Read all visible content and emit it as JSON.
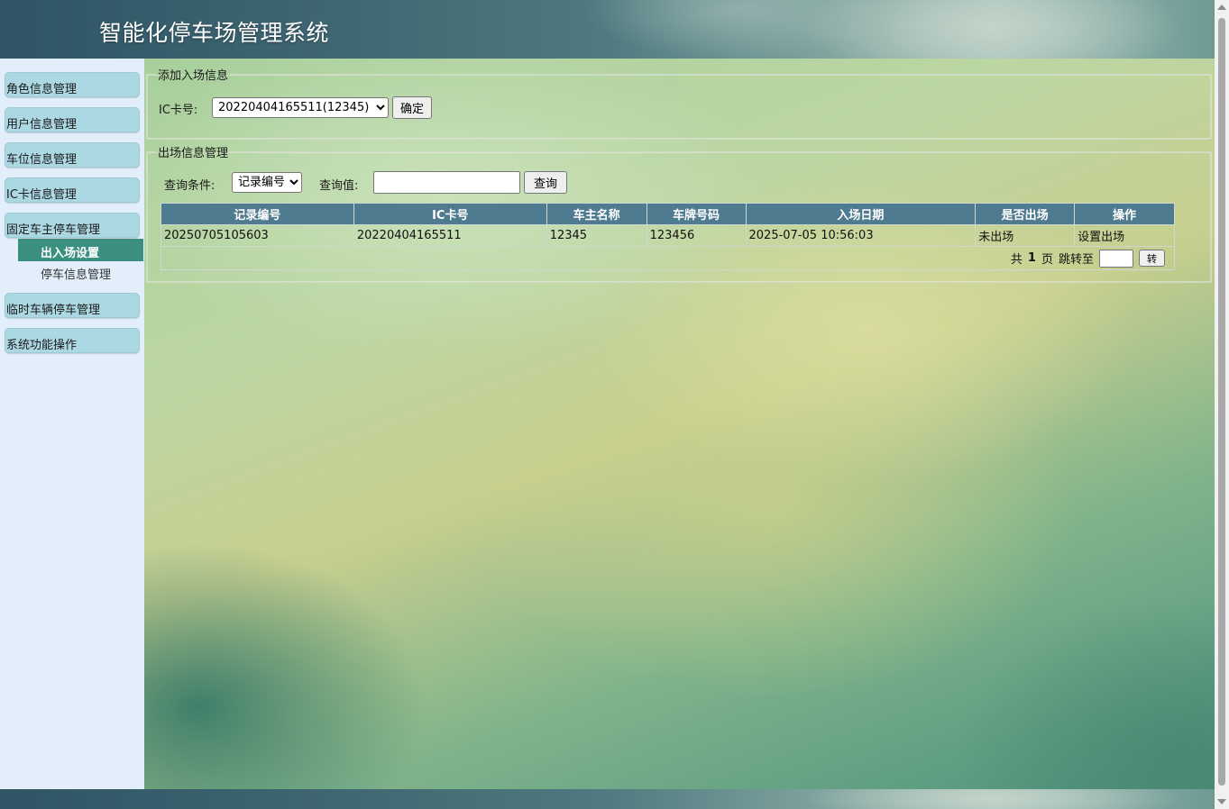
{
  "app": {
    "title": "智能化停车场管理系统"
  },
  "sidebar": {
    "items": [
      {
        "label": "角色信息管理"
      },
      {
        "label": "用户信息管理"
      },
      {
        "label": "车位信息管理"
      },
      {
        "label": "IC卡信息管理"
      },
      {
        "label": "固定车主停车管理"
      },
      {
        "label": "临时车辆停车管理"
      },
      {
        "label": "系统功能操作"
      }
    ],
    "submenu": {
      "active": "出入场设置",
      "other": "停车信息管理"
    }
  },
  "add_panel": {
    "legend": "添加入场信息",
    "ic_label": "IC卡号:",
    "ic_selected": "20220404165511(12345)",
    "confirm_label": "确定"
  },
  "exit_panel": {
    "legend": "出场信息管理",
    "query_condition_label": "查询条件:",
    "query_condition_selected": "记录编号",
    "query_value_label": "查询值:",
    "query_value": "",
    "query_button": "查询"
  },
  "table": {
    "headers": [
      "记录编号",
      "IC卡号",
      "车主名称",
      "车牌号码",
      "入场日期",
      "是否出场",
      "操作"
    ],
    "rows": [
      [
        "20250705105603",
        "20220404165511",
        "12345",
        "123456",
        "2025-07-05 10:56:03",
        "未出场",
        "设置出场"
      ]
    ]
  },
  "pager": {
    "prefix": "共",
    "total_pages": "1",
    "unit": "页",
    "jump_label": "跳转至",
    "jump_value": "",
    "go_button": "转"
  }
}
